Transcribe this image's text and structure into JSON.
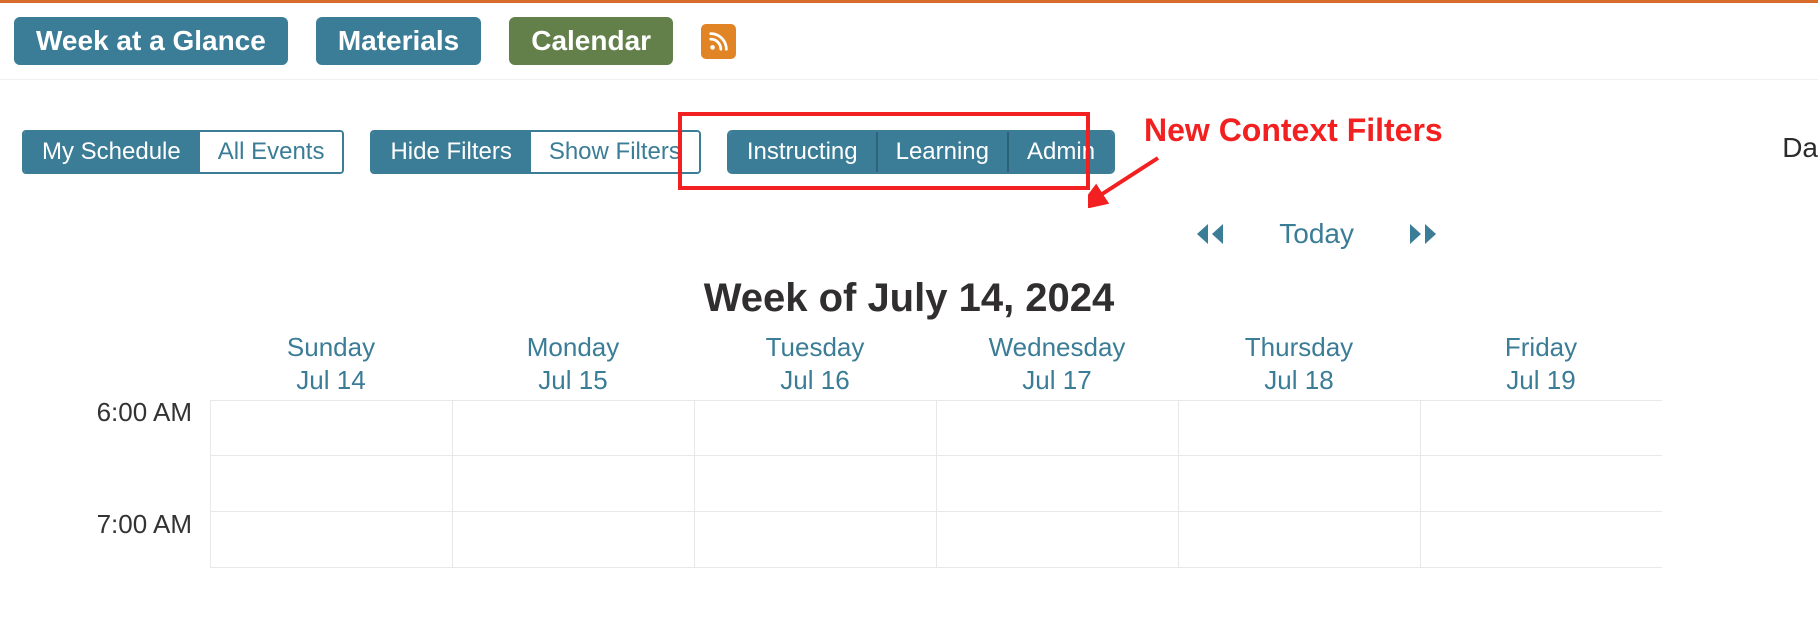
{
  "tabs": {
    "week_at_a_glance": "Week at a Glance",
    "materials": "Materials",
    "calendar": "Calendar"
  },
  "filters": {
    "my_schedule": "My Schedule",
    "all_events": "All Events",
    "hide_filters": "Hide Filters",
    "show_filters": "Show Filters",
    "instructing": "Instructing",
    "learning": "Learning",
    "admin": "Admin"
  },
  "annotation": {
    "label": "New Context Filters"
  },
  "nav": {
    "today": "Today"
  },
  "week_title": "Week of July 14, 2024",
  "right_partial": "Da",
  "days": [
    {
      "dow": "Sunday",
      "date": "Jul 14"
    },
    {
      "dow": "Monday",
      "date": "Jul 15"
    },
    {
      "dow": "Tuesday",
      "date": "Jul 16"
    },
    {
      "dow": "Wednesday",
      "date": "Jul 17"
    },
    {
      "dow": "Thursday",
      "date": "Jul 18"
    },
    {
      "dow": "Friday",
      "date": "Jul 19"
    }
  ],
  "times": [
    "6:00 AM",
    "7:00 AM"
  ]
}
